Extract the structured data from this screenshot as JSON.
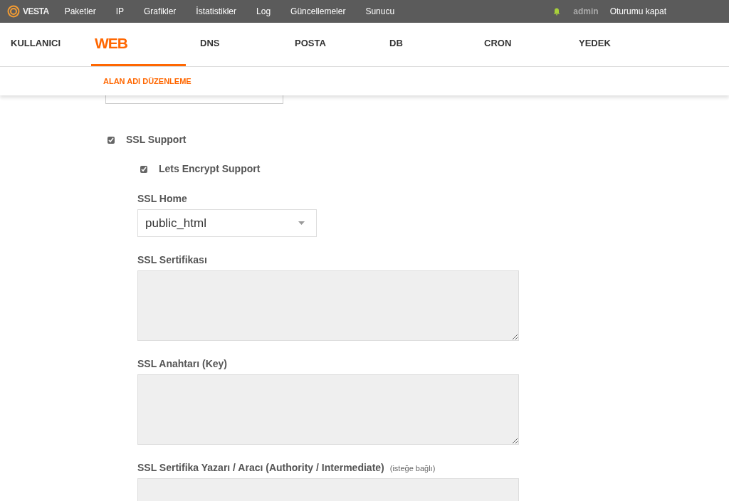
{
  "topbar": {
    "logo": "VESTA",
    "menu": [
      {
        "label": "Paketler"
      },
      {
        "label": "IP"
      },
      {
        "label": "Grafikler"
      },
      {
        "label": "İstatistikler"
      },
      {
        "label": "Log"
      },
      {
        "label": "Güncellemeler"
      },
      {
        "label": "Sunucu"
      }
    ],
    "user": "admin",
    "logout": "Oturumu kapat"
  },
  "tabs": [
    {
      "label": "KULLANICI",
      "selected": false
    },
    {
      "label": "WEB",
      "selected": true
    },
    {
      "label": "DNS",
      "selected": false
    },
    {
      "label": "POSTA",
      "selected": false
    },
    {
      "label": "DB",
      "selected": false
    },
    {
      "label": "CRON",
      "selected": false
    },
    {
      "label": "YEDEK",
      "selected": false
    }
  ],
  "subtitle": "ALAN ADI DÜZENLEME",
  "form": {
    "ssl_support": {
      "label": "SSL Support",
      "checked": true
    },
    "letsencrypt": {
      "label": "Lets Encrypt Support",
      "checked": true
    },
    "ssl_home": {
      "label": "SSL Home",
      "value": "public_html"
    },
    "textareas": [
      {
        "label": "SSL Sertifikası"
      },
      {
        "label": "SSL Anahtarı (Key)"
      },
      {
        "label": "SSL Sertifika Yazarı / Aracı (Authority / Intermediate)",
        "note": "(isteğe bağlı)"
      }
    ]
  }
}
